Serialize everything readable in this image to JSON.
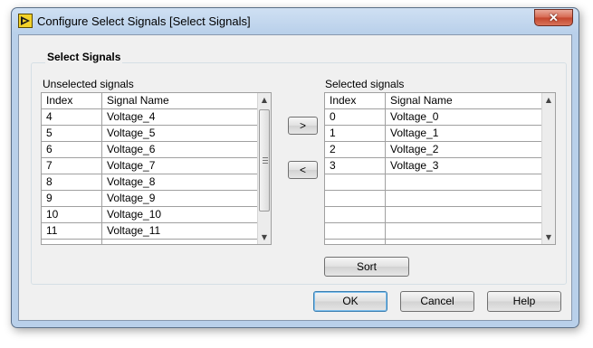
{
  "window": {
    "title": "Configure Select Signals [Select Signals]",
    "close_label": "✕"
  },
  "group": {
    "title": "Select Signals"
  },
  "unselected": {
    "label": "Unselected signals",
    "headers": {
      "index": "Index",
      "name": "Signal Name"
    },
    "rows": [
      {
        "index": "4",
        "name": "Voltage_4"
      },
      {
        "index": "5",
        "name": "Voltage_5"
      },
      {
        "index": "6",
        "name": "Voltage_6"
      },
      {
        "index": "7",
        "name": "Voltage_7"
      },
      {
        "index": "8",
        "name": "Voltage_8"
      },
      {
        "index": "9",
        "name": "Voltage_9"
      },
      {
        "index": "10",
        "name": "Voltage_10"
      },
      {
        "index": "11",
        "name": "Voltage_11"
      }
    ]
  },
  "selected": {
    "label": "Selected signals",
    "headers": {
      "index": "Index",
      "name": "Signal Name"
    },
    "rows": [
      {
        "index": "0",
        "name": "Voltage_0"
      },
      {
        "index": "1",
        "name": "Voltage_1"
      },
      {
        "index": "2",
        "name": "Voltage_2"
      },
      {
        "index": "3",
        "name": "Voltage_3"
      },
      {
        "index": "",
        "name": ""
      },
      {
        "index": "",
        "name": ""
      },
      {
        "index": "",
        "name": ""
      },
      {
        "index": "",
        "name": ""
      }
    ]
  },
  "buttons": {
    "add": ">",
    "remove": "<",
    "sort": "Sort",
    "ok": "OK",
    "cancel": "Cancel",
    "help": "Help"
  },
  "scroll": {
    "up": "▲",
    "down": "▼"
  }
}
